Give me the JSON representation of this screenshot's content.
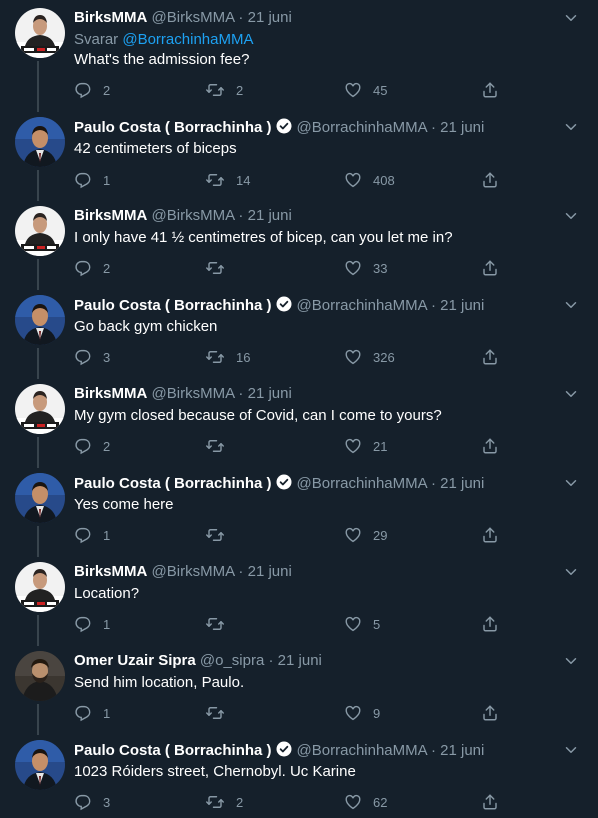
{
  "accent_color": "#1da1f2",
  "background_color": "#15202b",
  "tweets": [
    {
      "name": "BirksMMA",
      "handle": "@BirksMMA",
      "date": "21 juni",
      "verified": false,
      "avatar": "birks",
      "reply_prefix": "Svarar",
      "reply_to": "@BorrachinhaMMA",
      "text": "What's the admission fee?",
      "replies": "2",
      "retweets": "2",
      "likes": "45"
    },
    {
      "name": "Paulo Costa ( Borrachinha )",
      "handle": "@BorrachinhaMMA",
      "date": "21 juni",
      "verified": true,
      "avatar": "paulo",
      "text": "42 centimeters of biceps",
      "replies": "1",
      "retweets": "14",
      "likes": "408"
    },
    {
      "name": "BirksMMA",
      "handle": "@BirksMMA",
      "date": "21 juni",
      "verified": false,
      "avatar": "birks",
      "text": "I only have 41 ½ centimetres of bicep, can you let me in?",
      "replies": "2",
      "retweets": "",
      "likes": "33"
    },
    {
      "name": "Paulo Costa ( Borrachinha )",
      "handle": "@BorrachinhaMMA",
      "date": "21 juni",
      "verified": true,
      "avatar": "paulo",
      "text": "Go back gym chicken",
      "replies": "3",
      "retweets": "16",
      "likes": "326"
    },
    {
      "name": "BirksMMA",
      "handle": "@BirksMMA",
      "date": "21 juni",
      "verified": false,
      "avatar": "birks",
      "text": "My gym closed because of Covid, can I come to yours?",
      "replies": "2",
      "retweets": "",
      "likes": "21"
    },
    {
      "name": "Paulo Costa ( Borrachinha )",
      "handle": "@BorrachinhaMMA",
      "date": "21 juni",
      "verified": true,
      "avatar": "paulo",
      "text": "Yes come here",
      "replies": "1",
      "retweets": "",
      "likes": "29"
    },
    {
      "name": "BirksMMA",
      "handle": "@BirksMMA",
      "date": "21 juni",
      "verified": false,
      "avatar": "birks",
      "text": "Location?",
      "replies": "1",
      "retweets": "",
      "likes": "5"
    },
    {
      "name": "Omer Uzair Sipra",
      "handle": "@o_sipra",
      "date": "21 juni",
      "verified": false,
      "avatar": "omer",
      "text": "Send him location, Paulo.",
      "replies": "1",
      "retweets": "",
      "likes": "9"
    },
    {
      "name": "Paulo Costa ( Borrachinha )",
      "handle": "@BorrachinhaMMA",
      "date": "21 juni",
      "verified": true,
      "avatar": "paulo",
      "text": "1023 Róiders street, Chernobyl. Uc Karine",
      "replies": "3",
      "retweets": "2",
      "likes": "62"
    }
  ]
}
